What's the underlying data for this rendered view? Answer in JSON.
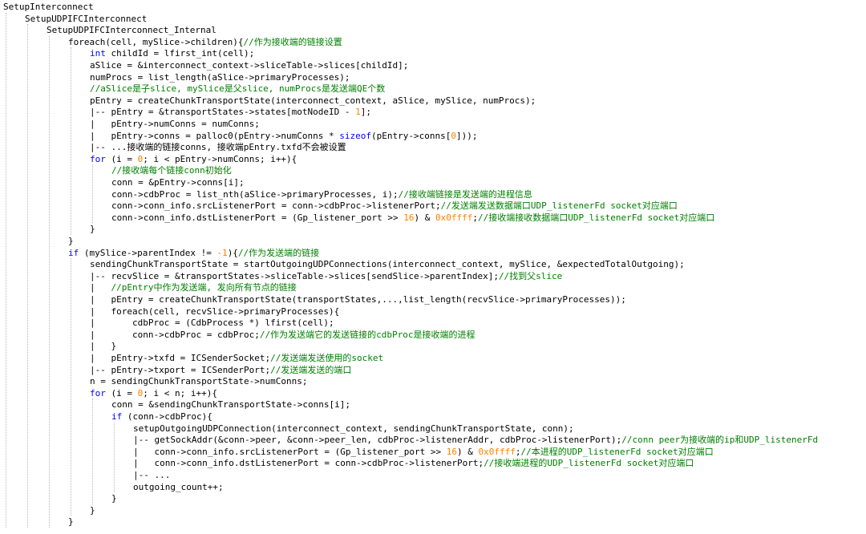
{
  "theme": {
    "background": "#ffffff",
    "text_color": "#000000",
    "keyword_color": "#0000ff",
    "comment_color": "#008000",
    "number_color": "#ff8000",
    "guide_color": "#b8b8b8"
  },
  "code_lines": [
    {
      "indent": 0,
      "tokens": [
        {
          "t": "SetupInterconnect",
          "c": "txt"
        }
      ]
    },
    {
      "indent": 1,
      "tokens": [
        {
          "t": "SetupUDPIFCInterconnect",
          "c": "txt"
        }
      ]
    },
    {
      "indent": 2,
      "tokens": [
        {
          "t": "SetupUDPIFCInterconnect_Internal",
          "c": "txt"
        }
      ]
    },
    {
      "indent": 3,
      "tokens": [
        {
          "t": "foreach(cell, mySlice->children){",
          "c": "txt"
        },
        {
          "t": "//作为接收端的链接设置",
          "c": "cm"
        }
      ]
    },
    {
      "indent": 4,
      "tokens": [
        {
          "t": "int",
          "c": "kw"
        },
        {
          "t": " childId = lfirst_int(cell);",
          "c": "txt"
        }
      ]
    },
    {
      "indent": 4,
      "tokens": [
        {
          "t": "aSlice = &interconnect_context->sliceTable->slices[childId];",
          "c": "txt"
        }
      ]
    },
    {
      "indent": 4,
      "tokens": [
        {
          "t": "numProcs = list_length(aSlice->primaryProcesses);",
          "c": "txt"
        }
      ]
    },
    {
      "indent": 4,
      "tokens": [
        {
          "t": "//aSlice是子slice, mySlice是父slice, numProcs是发送端QE个数",
          "c": "cm"
        }
      ]
    },
    {
      "indent": 4,
      "tokens": [
        {
          "t": "pEntry = createChunkTransportState(interconnect_context, aSlice, mySlice, numProcs);",
          "c": "txt"
        }
      ]
    },
    {
      "indent": 4,
      "tokens": [
        {
          "t": "|-- pEntry = &transportStates->states[motNodeID - ",
          "c": "txt"
        },
        {
          "t": "1",
          "c": "num"
        },
        {
          "t": "];",
          "c": "txt"
        }
      ]
    },
    {
      "indent": 4,
      "tokens": [
        {
          "t": "|   pEntry->numConns = numConns;",
          "c": "txt"
        }
      ]
    },
    {
      "indent": 4,
      "tokens": [
        {
          "t": "|   pEntry->conns = palloc0(pEntry->numConns * ",
          "c": "txt"
        },
        {
          "t": "sizeof",
          "c": "kw"
        },
        {
          "t": "(pEntry->conns[",
          "c": "txt"
        },
        {
          "t": "0",
          "c": "num"
        },
        {
          "t": "]));",
          "c": "txt"
        }
      ]
    },
    {
      "indent": 4,
      "tokens": [
        {
          "t": "|-- ...接收端的链接conns, 接收端pEntry.txfd不会被设置",
          "c": "txt"
        }
      ]
    },
    {
      "indent": 4,
      "tokens": [
        {
          "t": "for",
          "c": "kw"
        },
        {
          "t": " (i = ",
          "c": "txt"
        },
        {
          "t": "0",
          "c": "num"
        },
        {
          "t": "; i < pEntry->numConns; i++){",
          "c": "txt"
        }
      ]
    },
    {
      "indent": 5,
      "tokens": [
        {
          "t": "//接收端每个链接conn初始化",
          "c": "cm"
        }
      ]
    },
    {
      "indent": 5,
      "tokens": [
        {
          "t": "conn = &pEntry->conns[i];",
          "c": "txt"
        }
      ]
    },
    {
      "indent": 5,
      "tokens": [
        {
          "t": "conn->cdbProc = list_nth(aSlice->primaryProcesses, i);",
          "c": "txt"
        },
        {
          "t": "//接收端链接是发送端的进程信息",
          "c": "cm"
        }
      ]
    },
    {
      "indent": 5,
      "tokens": [
        {
          "t": "conn->conn_info.srcListenerPort = conn->cdbProc->listenerPort;",
          "c": "txt"
        },
        {
          "t": "//发送端发送数据端口UDP_listenerFd socket对应端口",
          "c": "cm"
        }
      ]
    },
    {
      "indent": 5,
      "tokens": [
        {
          "t": "conn->conn_info.dstListenerPort = (Gp_listener_port >> ",
          "c": "txt"
        },
        {
          "t": "16",
          "c": "num"
        },
        {
          "t": ") & ",
          "c": "txt"
        },
        {
          "t": "0x0ffff",
          "c": "num"
        },
        {
          "t": ";",
          "c": "txt"
        },
        {
          "t": "//接收端接收数据端口UDP_listenerFd socket对应端口",
          "c": "cm"
        }
      ]
    },
    {
      "indent": 4,
      "tokens": [
        {
          "t": "}",
          "c": "txt"
        }
      ]
    },
    {
      "indent": 3,
      "tokens": [
        {
          "t": "}",
          "c": "txt"
        }
      ]
    },
    {
      "indent": 3,
      "tokens": [
        {
          "t": "if",
          "c": "kw"
        },
        {
          "t": " (mySlice->parentIndex != ",
          "c": "txt"
        },
        {
          "t": "-1",
          "c": "num"
        },
        {
          "t": "){",
          "c": "txt"
        },
        {
          "t": "//作为发送端的链接",
          "c": "cm"
        }
      ]
    },
    {
      "indent": 4,
      "tokens": [
        {
          "t": "sendingChunkTransportState = startOutgoingUDPConnections(interconnect_context, mySlice, &expectedTotalOutgoing);",
          "c": "txt"
        }
      ]
    },
    {
      "indent": 4,
      "tokens": [
        {
          "t": "|-- recvSlice = &transportStates->sliceTable->slices[sendSlice->parentIndex];",
          "c": "txt"
        },
        {
          "t": "//找到父slice",
          "c": "cm"
        }
      ]
    },
    {
      "indent": 4,
      "tokens": [
        {
          "t": "|   ",
          "c": "txt"
        },
        {
          "t": "//pEntry中作为发送端, 发向所有节点的链接",
          "c": "cm"
        }
      ]
    },
    {
      "indent": 4,
      "tokens": [
        {
          "t": "|   pEntry = createChunkTransportState(transportStates,...,list_length(recvSlice->primaryProcesses));",
          "c": "txt"
        }
      ]
    },
    {
      "indent": 4,
      "tokens": [
        {
          "t": "|   foreach(cell, recvSlice->primaryProcesses){",
          "c": "txt"
        }
      ]
    },
    {
      "indent": 4,
      "tokens": [
        {
          "t": "|       cdbProc = (CdbProcess *) lfirst(cell);",
          "c": "txt"
        }
      ]
    },
    {
      "indent": 4,
      "tokens": [
        {
          "t": "|       conn->cdbProc = cdbProc;",
          "c": "txt"
        },
        {
          "t": "//作为发送端它的发送链接的cdbProc是接收端的进程",
          "c": "cm"
        }
      ]
    },
    {
      "indent": 4,
      "tokens": [
        {
          "t": "|   }",
          "c": "txt"
        }
      ]
    },
    {
      "indent": 4,
      "tokens": [
        {
          "t": "|   pEntry->txfd = ICSenderSocket;",
          "c": "txt"
        },
        {
          "t": "//发送端发送使用的socket",
          "c": "cm"
        }
      ]
    },
    {
      "indent": 4,
      "tokens": [
        {
          "t": "|-- pEntry->txport = ICSenderPort;",
          "c": "txt"
        },
        {
          "t": "//发送端发送的端口",
          "c": "cm"
        }
      ]
    },
    {
      "indent": 4,
      "tokens": [
        {
          "t": "n = sendingChunkTransportState->numConns;",
          "c": "txt"
        }
      ]
    },
    {
      "indent": 4,
      "tokens": [
        {
          "t": "for",
          "c": "kw"
        },
        {
          "t": " (i = ",
          "c": "txt"
        },
        {
          "t": "0",
          "c": "num"
        },
        {
          "t": "; i < n; i++){",
          "c": "txt"
        }
      ]
    },
    {
      "indent": 5,
      "tokens": [
        {
          "t": "conn = &sendingChunkTransportState->conns[i];",
          "c": "txt"
        }
      ]
    },
    {
      "indent": 5,
      "tokens": [
        {
          "t": "if",
          "c": "kw"
        },
        {
          "t": " (conn->cdbProc){",
          "c": "txt"
        }
      ]
    },
    {
      "indent": 6,
      "tokens": [
        {
          "t": "setupOutgoingUDPConnection(interconnect_context, sendingChunkTransportState, conn);",
          "c": "txt"
        }
      ]
    },
    {
      "indent": 6,
      "tokens": [
        {
          "t": "|-- getSockAddr(&conn->peer, &conn->peer_len, cdbProc->listenerAddr, cdbProc->listenerPort);",
          "c": "txt"
        },
        {
          "t": "//conn peer为接收端的ip和UDP_listenerFd",
          "c": "cm"
        }
      ]
    },
    {
      "indent": 6,
      "tokens": [
        {
          "t": "|   conn->conn_info.srcListenerPort = (Gp_listener_port >> ",
          "c": "txt"
        },
        {
          "t": "16",
          "c": "num"
        },
        {
          "t": ") & ",
          "c": "txt"
        },
        {
          "t": "0x0ffff",
          "c": "num"
        },
        {
          "t": ";",
          "c": "txt"
        },
        {
          "t": "//本进程的UDP_listenerFd socket对应端口",
          "c": "cm"
        }
      ]
    },
    {
      "indent": 6,
      "tokens": [
        {
          "t": "|   conn->conn_info.dstListenerPort = conn->cdbProc->listenerPort;",
          "c": "txt"
        },
        {
          "t": "//接收端进程的UDP_listenerFd socket对应端口",
          "c": "cm"
        }
      ]
    },
    {
      "indent": 6,
      "tokens": [
        {
          "t": "|-- ...",
          "c": "txt"
        }
      ]
    },
    {
      "indent": 6,
      "tokens": [
        {
          "t": "outgoing_count++;",
          "c": "txt"
        }
      ]
    },
    {
      "indent": 5,
      "tokens": [
        {
          "t": "}",
          "c": "txt"
        }
      ]
    },
    {
      "indent": 4,
      "tokens": [
        {
          "t": "}",
          "c": "txt"
        }
      ]
    },
    {
      "indent": 3,
      "tokens": [
        {
          "t": "}",
          "c": "txt"
        }
      ]
    }
  ]
}
